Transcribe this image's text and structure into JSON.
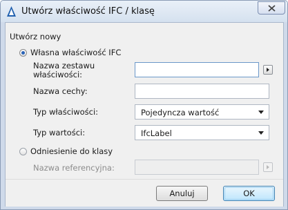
{
  "window": {
    "title": "Utwórz właściwość IFC / klasę"
  },
  "form": {
    "section_label": "Utwórz nowy",
    "option_property": {
      "label": "Własna właściwość IFC",
      "selected": true,
      "set_name_label_line1": "Nazwa zestawu",
      "set_name_label_line2": "właściwości:",
      "set_name_value": "",
      "feature_name_label": "Nazwa cechy:",
      "feature_name_value": "",
      "property_type_label": "Typ właściwości:",
      "property_type_value": "Pojedyncza wartość",
      "value_type_label": "Typ wartości:",
      "value_type_value": "IfcLabel"
    },
    "option_class": {
      "label": "Odniesienie do klasy",
      "selected": false,
      "reference_name_label": "Nazwa referencyjna:",
      "reference_name_value": ""
    }
  },
  "buttons": {
    "cancel_label": "Anuluj",
    "ok_label": "OK"
  },
  "icons": {
    "app": "archicad-app-icon",
    "close": "close-icon",
    "browse": "play-triangle-icon",
    "dropdown": "caret-down-icon"
  },
  "colors": {
    "title_bar": "#d5e1ef",
    "dialog_bg": "#f0f0f0",
    "radio_dot": "#2a64b8",
    "close_x": "#d73a3a"
  }
}
